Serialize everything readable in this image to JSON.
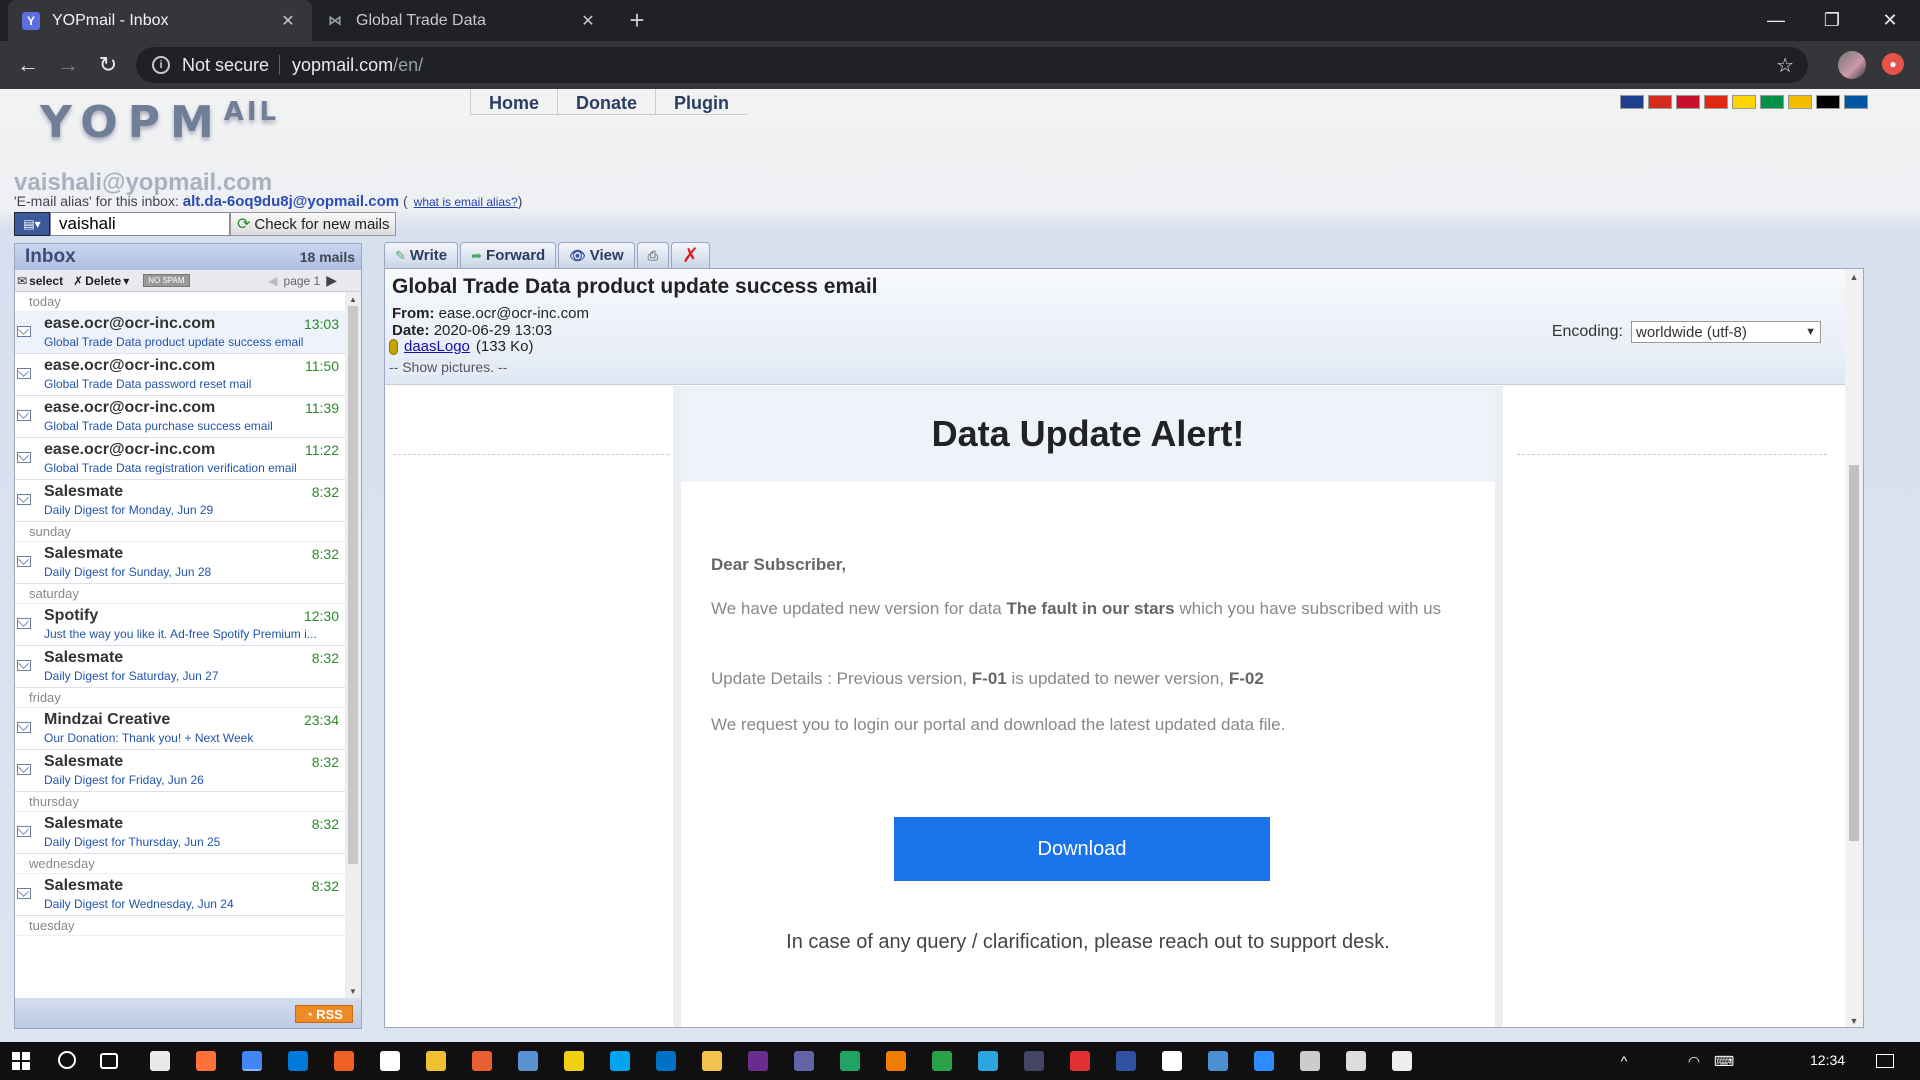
{
  "browser": {
    "tabs": [
      {
        "title": "YOPmail - Inbox",
        "favicon": "Y",
        "active": true
      },
      {
        "title": "Global Trade Data",
        "active": false
      }
    ],
    "security_label": "Not secure",
    "url_host": "yopmail.com",
    "url_path": "/en/"
  },
  "site": {
    "logo_text": "YOPM",
    "logo_suffix": "AIL",
    "nav": [
      "Home",
      "Donate",
      "Plugin"
    ],
    "flag_colors": [
      "#1f3f8f",
      "#d52b1e",
      "#c8102e",
      "#de2910",
      "#ffd500",
      "#009246",
      "#f1bf00",
      "#000000",
      "#0055a4"
    ]
  },
  "inbox_address": "vaishali@yopmail.com",
  "alias": {
    "prefix": "'E-mail alias' for this inbox:",
    "value": "alt.da-6oq9du8j@yopmail.com",
    "help_link": "what is email alias?"
  },
  "login": {
    "value": "vaishali",
    "check_button": "Check for new mails"
  },
  "inbox": {
    "title": "Inbox",
    "count": "18 mails",
    "tools": {
      "select": "select",
      "delete": "Delete",
      "nospam": "NO SPAM",
      "page": "page 1"
    },
    "rss": "RSS",
    "groups": [
      {
        "day": "today",
        "mails": [
          {
            "from": "ease.ocr@ocr-inc.com",
            "time": "13:03",
            "subject": "Global Trade Data product update success email",
            "selected": true
          },
          {
            "from": "ease.ocr@ocr-inc.com",
            "time": "11:50",
            "subject": "Global Trade Data password reset mail"
          },
          {
            "from": "ease.ocr@ocr-inc.com",
            "time": "11:39",
            "subject": "Global Trade Data purchase success email"
          },
          {
            "from": "ease.ocr@ocr-inc.com",
            "time": "11:22",
            "subject": "Global Trade Data registration verification email"
          },
          {
            "from": "Salesmate",
            "time": "8:32",
            "subject": "Daily Digest for Monday, Jun 29"
          }
        ]
      },
      {
        "day": "sunday",
        "mails": [
          {
            "from": "Salesmate",
            "time": "8:32",
            "subject": "Daily Digest for Sunday, Jun 28"
          }
        ]
      },
      {
        "day": "saturday",
        "mails": [
          {
            "from": "Spotify",
            "time": "12:30",
            "subject": "Just the way you like it. Ad-free Spotify Premium i..."
          },
          {
            "from": "Salesmate",
            "time": "8:32",
            "subject": "Daily Digest for Saturday, Jun 27"
          }
        ]
      },
      {
        "day": "friday",
        "mails": [
          {
            "from": "Mindzai Creative",
            "time": "23:34",
            "subject": "Our Donation: Thank you! + Next Week"
          },
          {
            "from": "Salesmate",
            "time": "8:32",
            "subject": "Daily Digest for Friday, Jun 26"
          }
        ]
      },
      {
        "day": "thursday",
        "mails": [
          {
            "from": "Salesmate",
            "time": "8:32",
            "subject": "Daily Digest for Thursday, Jun 25"
          }
        ]
      },
      {
        "day": "wednesday",
        "mails": [
          {
            "from": "Salesmate",
            "time": "8:32",
            "subject": "Daily Digest for Wednesday, Jun 24"
          }
        ]
      },
      {
        "day": "tuesday",
        "mails": []
      }
    ]
  },
  "mail_toolbar": {
    "write": "Write",
    "forward": "Forward",
    "view": "View"
  },
  "mail": {
    "subject": "Global Trade Data product update success email",
    "from_label": "From:",
    "from": "ease.ocr@ocr-inc.com",
    "date_label": "Date:",
    "date": "2020-06-29 13:03",
    "attachment_name": "daasLogo",
    "attachment_size": "(133 Ko)",
    "show_pictures": "-- Show pictures. --",
    "encoding_label": "Encoding:",
    "encoding_value": "worldwide (utf-8)",
    "body": {
      "headline": "Data Update Alert!",
      "greeting": "Dear Subscriber,",
      "line1_pre": "We have updated new version for data ",
      "line1_bold": "The fault in our stars",
      "line1_post": " which you have subscribed with us",
      "line2_pre": "Update Details : Previous version, ",
      "line2_old": "F-01",
      "line2_mid": " is updated to newer version, ",
      "line2_new": "F-02",
      "line3": "We request you to login our portal and download the latest updated data file.",
      "download_button": "Download",
      "support": "In case of any query / clarification, please reach out to support desk."
    }
  },
  "taskbar": {
    "clock": "12:34"
  }
}
